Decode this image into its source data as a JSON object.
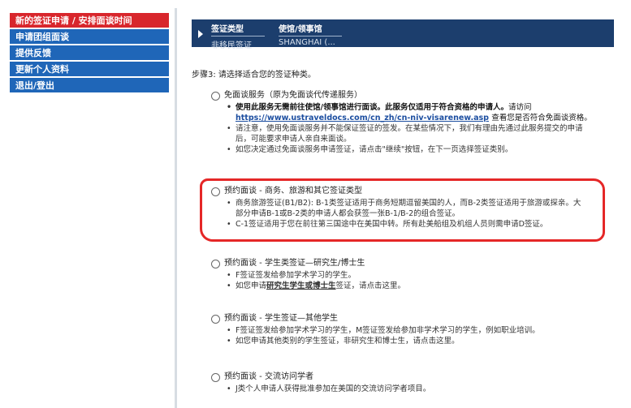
{
  "sidebar": {
    "items": [
      {
        "label": "新的签证申请 / 安排面谈时间",
        "active": true
      },
      {
        "label": "申请团组面谈",
        "active": false
      },
      {
        "label": "提供反馈",
        "active": false
      },
      {
        "label": "更新个人资料",
        "active": false
      },
      {
        "label": "退出/登出",
        "active": false
      }
    ]
  },
  "header": {
    "col1": {
      "label": "签证类型",
      "value": "非移民签证"
    },
    "col2": {
      "label": "使馆/领事馆",
      "value": "SHANGHAI (..."
    }
  },
  "main": {
    "step_text": "步骤3: 请选择适合您的签证种类。",
    "options": [
      {
        "title": "免面谈服务（原为免面谈代传递服务）",
        "b1_bold": "使用此服务无需前往使馆/领事馆进行面谈。此服务仅适用于符合资格的申请人。",
        "b1_plain": "请访问",
        "b1_link": "https://www.ustraveldocs.com/cn_zh/cn-niv-visarenew.asp",
        "b1_after": "查看您是否符合免面谈资格。",
        "b2": "请注意，使用免面谈服务并不能保证签证的签发。在某些情况下，我们有理由先通过此服务提交的申请",
        "b2_cont": "后，可能要求申请人亲自来面谈。",
        "b3": "如您决定通过免面谈服务申请签证，请点击\"继续\"按钮，在下一页选择签证类别。"
      },
      {
        "title": "预约面谈 - 商务、旅游和其它签证类型",
        "b1": "商务旅游签证(B1/B2): B-1类签证适用于商务短期逗留美国的人，而B-2类签证适用于旅游或探亲。大",
        "b1_cont": "部分申请B-1或B-2类的申请人都会获签一张B-1/B-2的组合签证。",
        "b2": "C-1签证适用于您在前往第三国途中在美国中转。所有赴美船组及机组人员则需申请D签证。"
      },
      {
        "title": "预约面谈 - 学生类签证—研究生/博士生",
        "b1": "F签证签发给参加学术学习的学生。",
        "b2_pre": "如您申请",
        "b2_link": "研究生学生或博士生",
        "b2_post": "签证，请点击这里。"
      },
      {
        "title": "预约面谈 - 学生签证—其他学生",
        "b1": "F签证签发给参加学术学习的学生，M签证签发给参加非学术学习的学生，例如职业培训。",
        "b2": "如您申请其他类别的学生签证，非研究生和博士生，请点击这里。"
      },
      {
        "title": "预约面谈 - 交流访问学者",
        "b1": "J类个人申请人获得批准参加在美国的交流访问学者项目。"
      }
    ]
  },
  "colors": {
    "sidebar_blue": "#1f66b8",
    "sidebar_active_red": "#d8262c",
    "header_navy": "#1c3e6d",
    "annotation_red": "#e52727"
  }
}
